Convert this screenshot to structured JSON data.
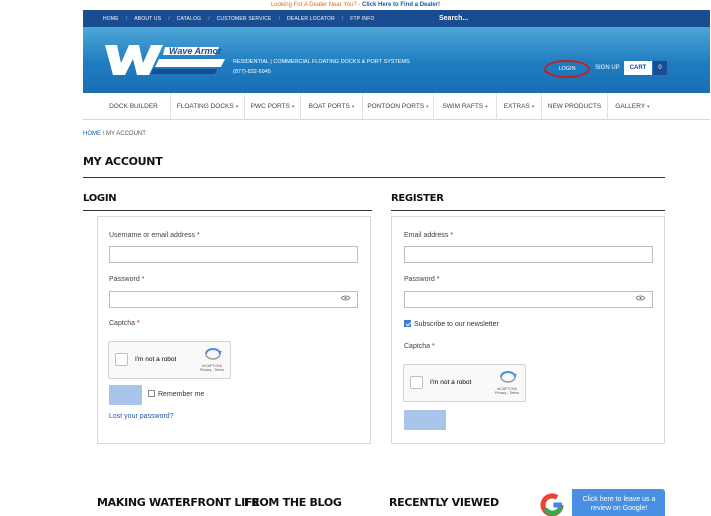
{
  "topbar": {
    "text": "Looking For A Dealer Near You? - ",
    "link": "Click Here to Find a Dealer!"
  },
  "navstrip": {
    "items": [
      "HOME",
      "ABOUT US",
      "CATALOG",
      "CUSTOMER SERVICE",
      "DEALER LOCATOR",
      "FTP INFO"
    ],
    "separator": "/",
    "search_placeholder": "Search..."
  },
  "banner": {
    "logo_text": "Wave Armor",
    "tagline": "RESIDENTIAL | COMMERCIAL FLOATING DOCKS & PORT SYSTEMS",
    "phone": "(877)-832-6945",
    "login": "LOGIN",
    "signup": "SIGN UP",
    "cart": "CART",
    "cart_count": "0"
  },
  "mainnav": {
    "items": [
      {
        "label": "DOCK BUILDER",
        "dropdown": false
      },
      {
        "label": "FLOATING DOCKS",
        "dropdown": true
      },
      {
        "label": "PWC PORTS",
        "dropdown": true
      },
      {
        "label": "BOAT PORTS",
        "dropdown": true
      },
      {
        "label": "PONTOON PORTS",
        "dropdown": true
      },
      {
        "label": "SWIM RAFTS",
        "dropdown": true
      },
      {
        "label": "EXTRAS",
        "dropdown": true
      },
      {
        "label": "NEW PRODUCTS",
        "dropdown": false
      },
      {
        "label": "GALLERY",
        "dropdown": true
      }
    ],
    "caret": "▾"
  },
  "breadcrumb": {
    "home": "HOME",
    "separator": " \\ ",
    "current": "MY ACCOUNT"
  },
  "page_title": "MY ACCOUNT",
  "login": {
    "heading": "LOGIN",
    "username_label": "Username or email address",
    "password_label": "Password",
    "captcha_label": "Captcha",
    "required": "*",
    "remember_label": "Remember me",
    "lost_password": "Lost your password?"
  },
  "register": {
    "heading": "REGISTER",
    "email_label": "Email address",
    "password_label": "Password",
    "newsletter_label": "Subscribe to our newsletter",
    "newsletter_checked": true,
    "captcha_label": "Captcha",
    "required": "*"
  },
  "recaptcha": {
    "robot_text": "I'm not a robot",
    "brand": "reCAPTCHA",
    "links": "Privacy - Terms"
  },
  "footer": {
    "col1": "MAKING WATERFRONT LIFE",
    "col2": "FROM THE BLOG",
    "col3": "RECENTLY VIEWED",
    "google_cta": "Click here to leave us a review on Google!"
  },
  "colors": {
    "nav_blue": "#1a4c92",
    "accent_orange": "#e26b22",
    "link_blue": "#1e59a8",
    "login_circle": "#c3201f",
    "button_blue": "#a9c4ea"
  }
}
